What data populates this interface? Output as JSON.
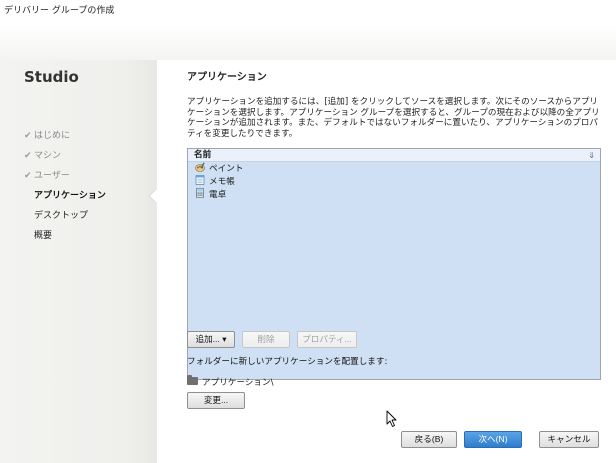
{
  "window": {
    "title": "デリバリー グループの作成"
  },
  "sidebar": {
    "brand": "Studio",
    "steps": [
      {
        "label": "はじめに",
        "state": "done",
        "check": "✔"
      },
      {
        "label": "マシン",
        "state": "done",
        "check": "✔"
      },
      {
        "label": "ユーザー",
        "state": "done",
        "check": "✔"
      },
      {
        "label": "アプリケーション",
        "state": "current"
      },
      {
        "label": "デスクトップ",
        "state": "todo"
      },
      {
        "label": "概要",
        "state": "todo"
      }
    ]
  },
  "main": {
    "heading": "アプリケーション",
    "description": "アプリケーションを追加するには、[追加] をクリックしてソースを選択します。次にそのソースからアプリケーションを選択します。アプリケーション グループを選択すると、グループの現在および以降の全アプリケーションが追加されます。また、デフォルトではないフォルダーに置いたり、アプリケーションのプロパティを変更したりできます。",
    "list": {
      "column_header": "名前",
      "sort_glyph": "⇓",
      "items": [
        {
          "name": "ペイント",
          "icon": "paint-icon"
        },
        {
          "name": "メモ帳",
          "icon": "notepad-icon"
        },
        {
          "name": "電卓",
          "icon": "calculator-icon"
        }
      ]
    },
    "buttons": {
      "add": "追加... ▾",
      "remove": "削除",
      "properties": "プロパティ..."
    },
    "folder_label": "フォルダーに新しいアプリケーションを配置します:",
    "folder_path": "アプリケーション\\",
    "change_button": "変更..."
  },
  "footer": {
    "back": "戻る(B)",
    "next": "次へ(N)",
    "cancel": "キャンセル"
  },
  "colors": {
    "list_background": "#cfe0f4",
    "primary_button": "#3a86d2"
  }
}
